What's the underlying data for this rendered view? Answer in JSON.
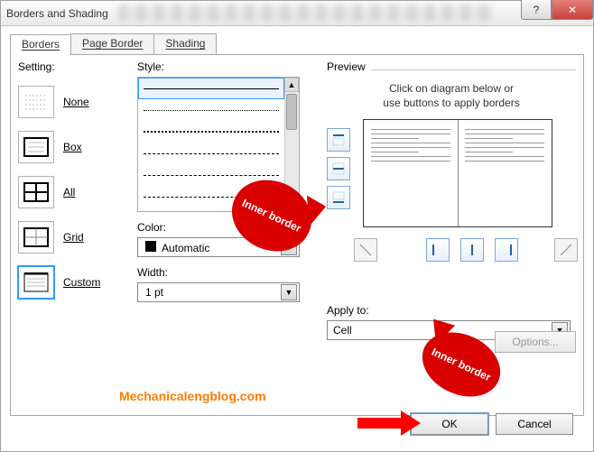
{
  "window": {
    "title": "Borders and Shading"
  },
  "tabs": {
    "borders": "Borders",
    "page_border": "Page Border",
    "shading": "Shading"
  },
  "settings": {
    "label": "Setting:",
    "none": "None",
    "box": "Box",
    "all": "All",
    "grid": "Grid",
    "custom": "Custom"
  },
  "style": {
    "label": "Style:",
    "color_label": "Color:",
    "color_value": "Automatic",
    "width_label": "Width:",
    "width_value": "1 pt"
  },
  "preview": {
    "label": "Preview",
    "instructions_line1": "Click on diagram below or",
    "instructions_line2": "use buttons to apply borders",
    "apply_label": "Apply to:",
    "apply_value": "Cell",
    "options": "Options..."
  },
  "buttons": {
    "ok": "OK",
    "cancel": "Cancel",
    "help": "?",
    "close": "✕"
  },
  "annotations": {
    "callout1": "Inner border",
    "callout2": "Inner border",
    "watermark": "Mechanicalengblog.com"
  }
}
